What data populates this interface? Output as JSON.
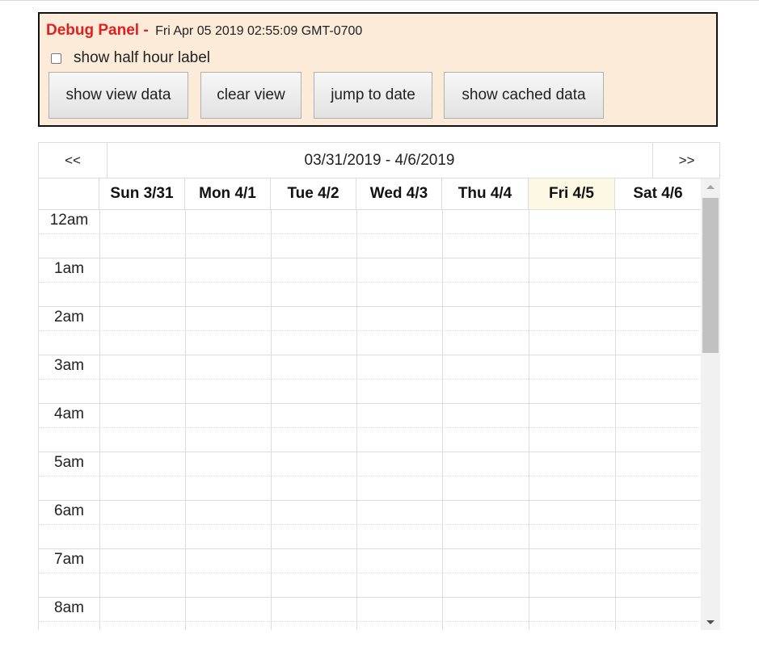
{
  "debug_panel": {
    "label": "Debug Panel -",
    "timestamp": "Fri Apr 05 2019 02:55:09 GMT-0700",
    "checkbox_label": "show half hour label",
    "buttons": {
      "show_view_data": "show view data",
      "clear_view": "clear view",
      "jump_to_date": "jump to date",
      "show_cached_data": "show cached data"
    }
  },
  "calendar": {
    "prev": "<<",
    "next": ">>",
    "range": "03/31/2019 - 4/6/2019",
    "days": [
      "Sun 3/31",
      "Mon 4/1",
      "Tue 4/2",
      "Wed 4/3",
      "Thu 4/4",
      "Fri 4/5",
      "Sat 4/6"
    ],
    "today_index": 5,
    "hours": [
      "12am",
      "1am",
      "2am",
      "3am",
      "4am",
      "5am",
      "6am",
      "7am",
      "8am"
    ]
  },
  "colors": {
    "debug_bg": "#fcebd9",
    "debug_label": "#e0201f",
    "today_bg": "#fcf8e3",
    "grid_line": "#dcdcdc"
  }
}
